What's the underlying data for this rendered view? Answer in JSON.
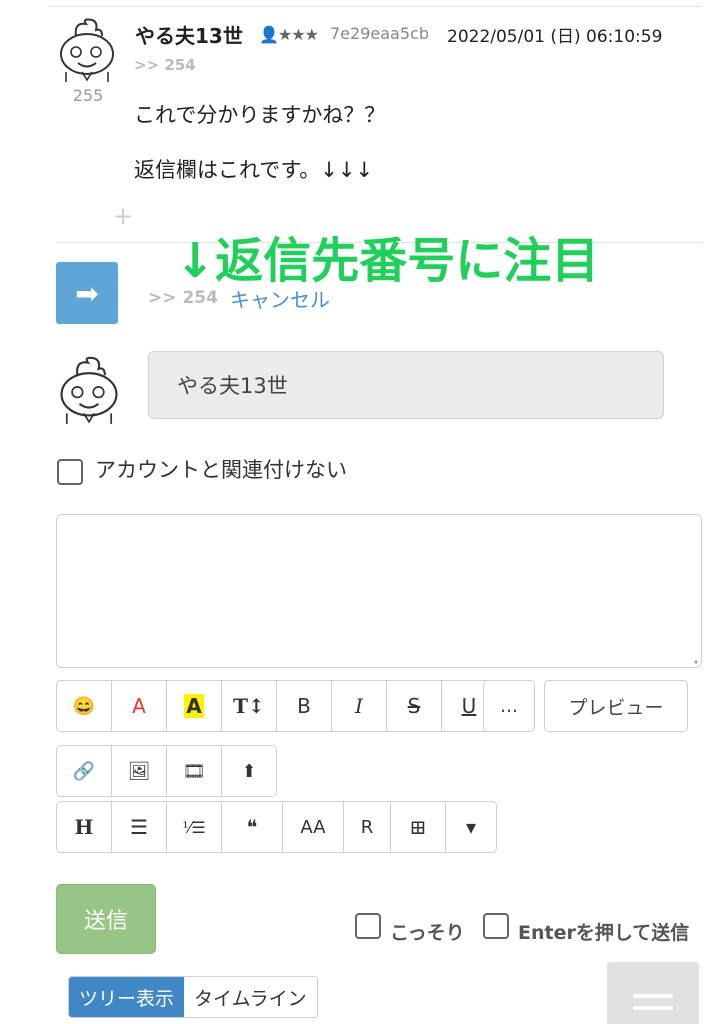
{
  "post": {
    "number": "255",
    "author": "やる夫13世",
    "rank": "👤★★★",
    "user_id": "7e29eaa5cb",
    "date": "2022/05/01 (日) 06:10:59",
    "reply_ref": ">> 254",
    "lines": [
      "これで分かりますかね？？",
      "返信欄はこれです。↓↓↓"
    ],
    "more": "+"
  },
  "annotation": "↓返信先番号に注目",
  "reply": {
    "arrow": "➡",
    "target": ">> 254",
    "cancel": "キャンセル"
  },
  "form": {
    "name_value": "やる夫13世",
    "no_account_label": "アカウントと関連付けない",
    "body_value": ""
  },
  "toolbar": {
    "row1": [
      "😄",
      "A",
      "A",
      "T↕",
      "B",
      "I",
      "S",
      "U"
    ],
    "more": "...",
    "preview": "プレビュー",
    "row2": [
      "🔗",
      "🖼",
      "🎞",
      "⬆"
    ],
    "row3": [
      "H",
      "☰",
      "⅟☰",
      "❝",
      "AA",
      "R",
      "⊞",
      "▾"
    ]
  },
  "submit": {
    "send": "送信",
    "sneak": "こっそり",
    "enter_send": "Enterを押して送信"
  },
  "view": {
    "tree": "ツリー表示",
    "timeline": "タイムライン"
  },
  "colors": {
    "annotation": "#21d05a",
    "reply_button": "#5fa6d8",
    "send_button": "#97c585",
    "active_tab": "#3f88c5",
    "font_red": "#e53935",
    "highlight": "#fff200"
  }
}
